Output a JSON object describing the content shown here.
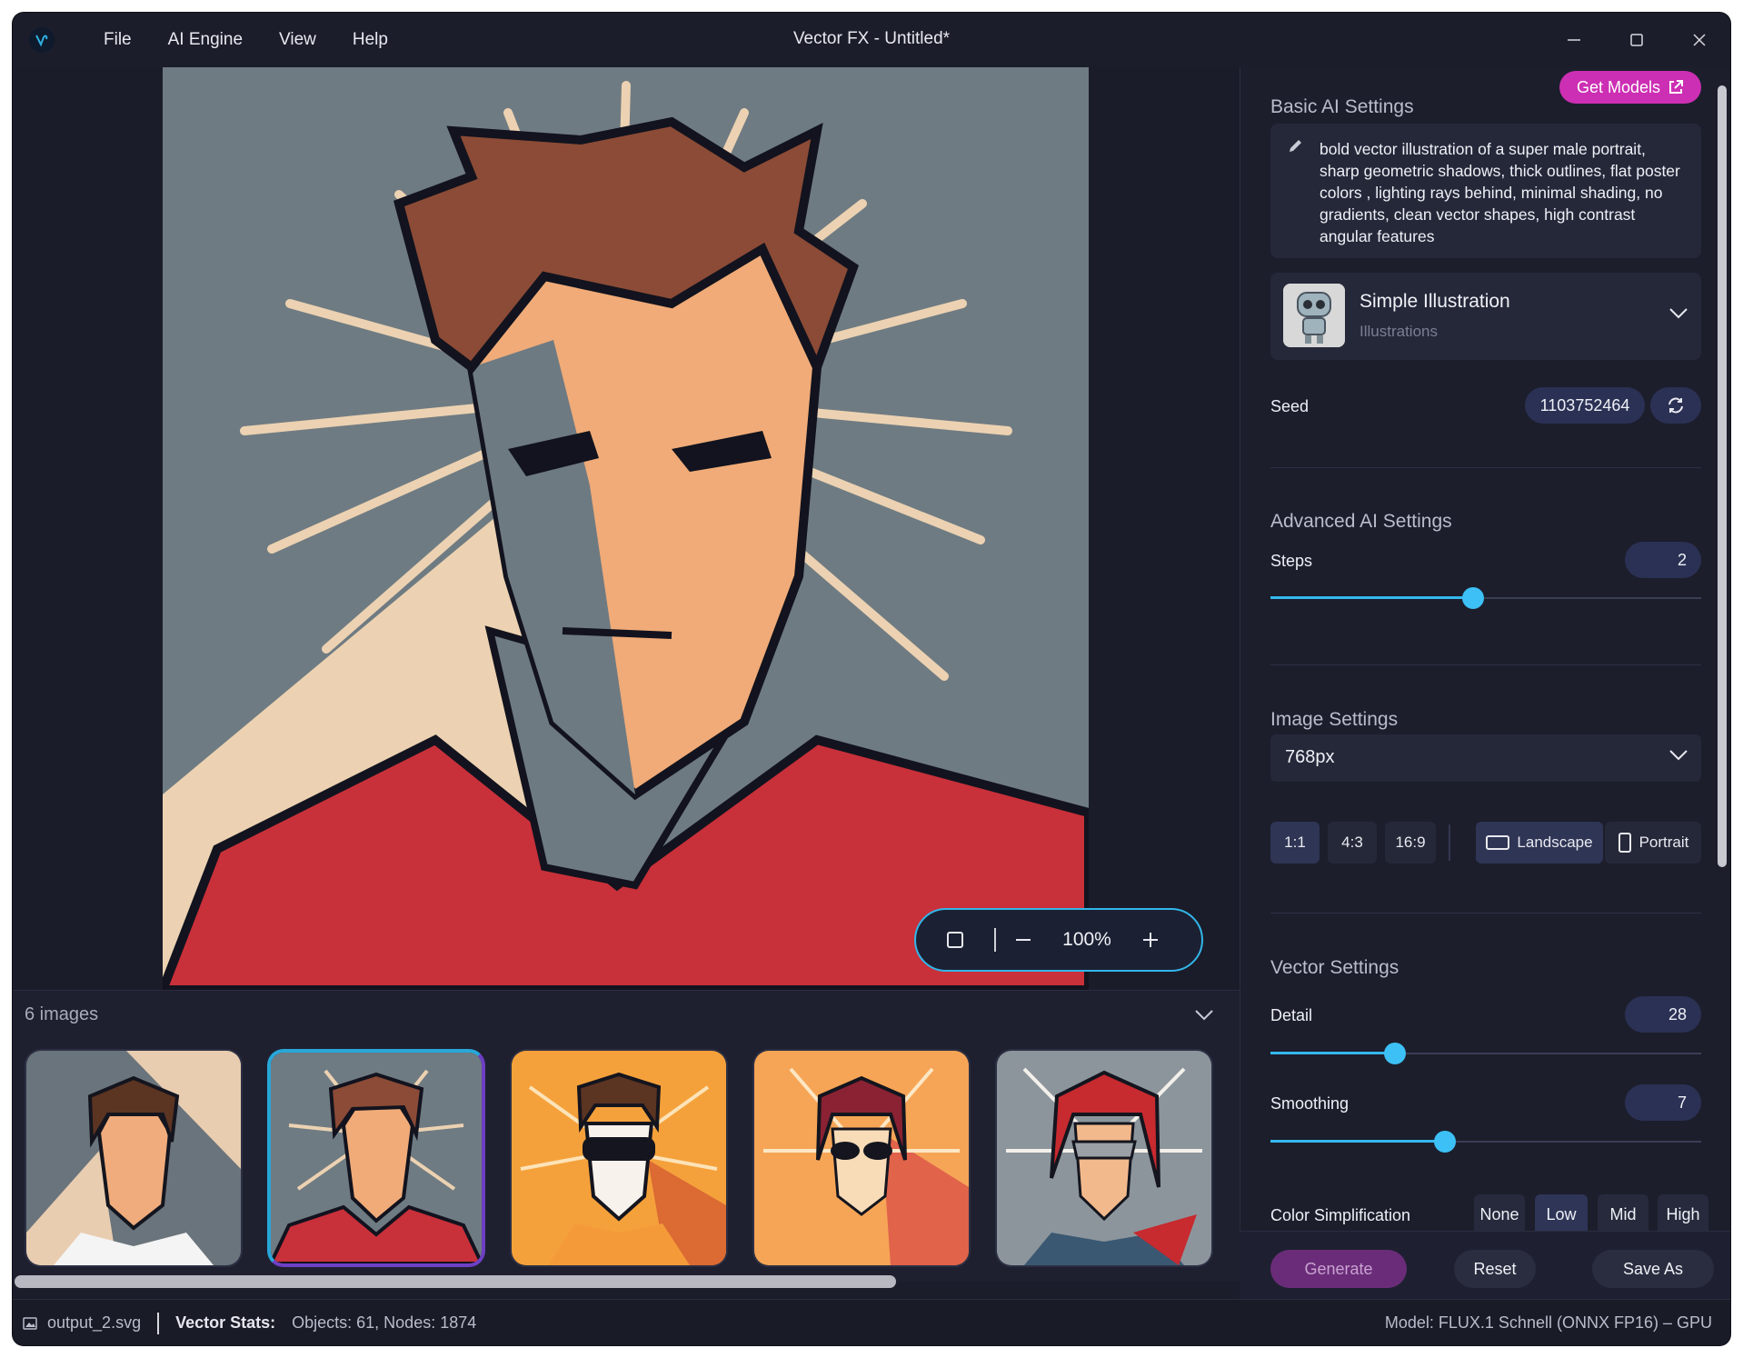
{
  "window": {
    "title": "Vector FX - Untitled*",
    "menu": [
      "File",
      "AI Engine",
      "View",
      "Help"
    ]
  },
  "canvas": {
    "zoom": "100%"
  },
  "gallery": {
    "count_label": "6 images",
    "selected_index": 1
  },
  "panel": {
    "basic_title": "Basic AI Settings",
    "get_models_label": "Get Models",
    "prompt": "bold vector illustration of a super male portrait, sharp geometric shadows, thick outlines, flat poster colors , lighting rays behind, minimal shading, no gradients, clean vector shapes, high contrast angular features",
    "model": {
      "name": "Simple Illustration",
      "category": "Illustrations"
    },
    "seed_label": "Seed",
    "seed_value": "1103752464",
    "advanced_title": "Advanced AI Settings",
    "steps_label": "Steps",
    "steps_value": "2",
    "steps_fraction": 0.47,
    "image_title": "Image Settings",
    "resolution": "768px",
    "aspect_ratios": [
      "1:1",
      "4:3",
      "16:9"
    ],
    "orientation": [
      "Landscape",
      "Portrait"
    ],
    "vector_title": "Vector Settings",
    "detail_label": "Detail",
    "detail_value": "28",
    "detail_fraction": 0.29,
    "smoothing_label": "Smoothing",
    "smoothing_value": "7",
    "smoothing_fraction": 0.405,
    "color_simplification_label": "Color Simplification",
    "color_simplification_options": [
      "None",
      "Low",
      "Mid",
      "High"
    ],
    "actions": {
      "generate": "Generate",
      "reset": "Reset",
      "save_as": "Save As"
    }
  },
  "status": {
    "file": "output_2.svg",
    "stats_label": "Vector Stats:",
    "stats": "Objects: 61, Nodes: 1874",
    "model": "Model: FLUX.1 Schnell (ONNX FP16) – GPU"
  },
  "colors": {
    "accent": "#36b8ee",
    "brand": "#cc2fb3",
    "generate": "#6a2c78"
  }
}
